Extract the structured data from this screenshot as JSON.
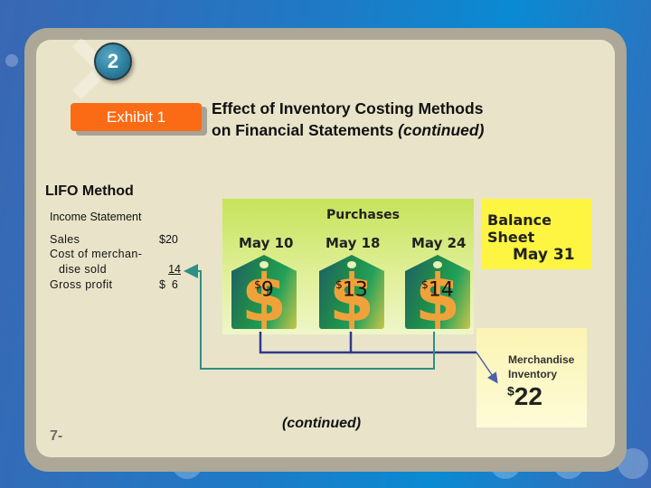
{
  "slide": {
    "section_number": "2",
    "exhibit_label": "Exhibit 1",
    "title_line1": "Effect of Inventory Costing Methods",
    "title_line2": "on Financial Statements ",
    "title_suffix": "(continued)",
    "method": "LIFO Method",
    "page_number": "7-",
    "footer_note": "(continued)"
  },
  "income_statement": {
    "heading": "Income Statement",
    "rows": [
      {
        "label": "Sales",
        "value": "$20"
      },
      {
        "label": "Cost of merchan-",
        "value": ""
      },
      {
        "label": "dise sold",
        "value": "14"
      },
      {
        "label": "Gross profit",
        "value": "$  6"
      }
    ]
  },
  "purchases": {
    "heading": "Purchases",
    "items": [
      {
        "date": "May 10",
        "currency": "$",
        "amount": "9"
      },
      {
        "date": "May 18",
        "currency": "$",
        "amount": "13"
      },
      {
        "date": "May 24",
        "currency": "$",
        "amount": "14"
      }
    ]
  },
  "balance_sheet": {
    "heading": "Balance Sheet",
    "date": "May 31"
  },
  "merchandise_inventory": {
    "label_line1": "Merchandise",
    "label_line2": "Inventory",
    "currency": "$",
    "amount": "22"
  },
  "colors": {
    "exhibit_orange": "#fb6a14",
    "panel_bg": "#e9e4c9",
    "inventory_line": "#2d3a8c",
    "cogs_line": "#2e8f86",
    "balance_sheet_yellow": "#fdf541",
    "price_tag_dollar": "#f0a23a"
  }
}
